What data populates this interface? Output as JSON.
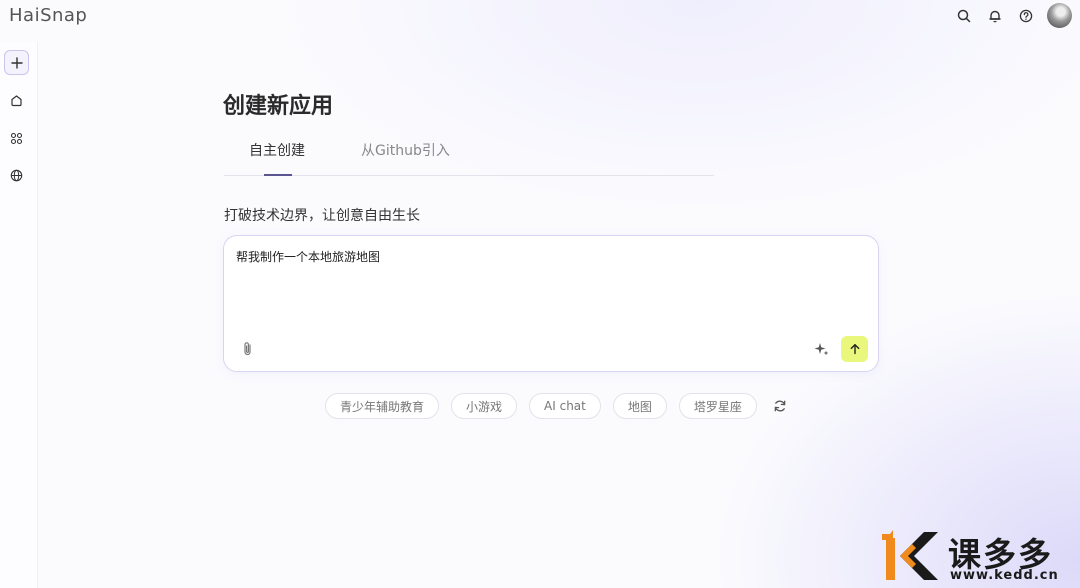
{
  "app": {
    "logo": "HaiSnap"
  },
  "header": {
    "icons": [
      "search-icon",
      "bell-icon",
      "help-icon",
      "avatar"
    ]
  },
  "sidebar": {
    "items": [
      {
        "icon": "plus-icon",
        "label": ""
      },
      {
        "icon": "home-icon",
        "label": ""
      },
      {
        "icon": "apps-icon",
        "label": ""
      },
      {
        "icon": "globe-icon",
        "label": ""
      }
    ]
  },
  "main": {
    "title": "创建新应用",
    "tabs": [
      {
        "label": "自主创建",
        "active": true
      },
      {
        "label": "从Github引入",
        "active": false
      }
    ],
    "subtitle": "打破技术边界，让创意自由生长",
    "prompt": {
      "value": "帮我制作一个本地旅游地图",
      "attach_icon": "paperclip-icon",
      "enhance_icon": "sparkle-icon",
      "send_icon": "arrow-up-icon"
    },
    "suggestions": [
      "青少年辅助教育",
      "小游戏",
      "AI chat",
      "地图",
      "塔罗星座"
    ],
    "refresh_icon": "refresh-icon"
  },
  "watermark": {
    "text": "课多多",
    "url": "www.kedd.cn"
  },
  "colors": {
    "accent": "#5a5490",
    "send_button": "#e9f77d",
    "border": "#d7d5f3"
  }
}
